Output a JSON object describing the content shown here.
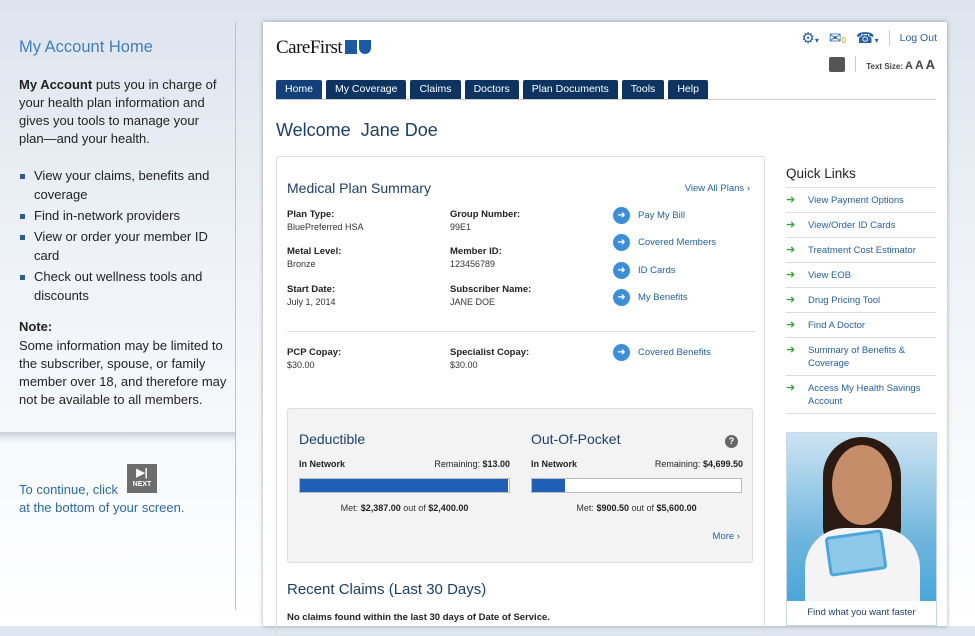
{
  "sidebar": {
    "title": "My Account Home",
    "intro_bold": "My Account",
    "intro_rest": " puts you in charge of your health plan information and gives you tools to manage your plan—and your health.",
    "bullets": [
      "View your claims, benefits and coverage",
      "Find in-network providers",
      "View or order your member ID card",
      "Check out wellness tools and discounts"
    ],
    "note_heading": "Note:",
    "note_text": "Some information may be limited to the subscriber, spouse, or family member over 18, and therefore may not be available to all members.",
    "continue_text_1": "To continue, click",
    "continue_text_2": "at the bottom of your screen.",
    "next_label": "NEXT"
  },
  "header": {
    "logo_text": "CareFirst",
    "mail_badge": "0",
    "logout": "Log Out",
    "text_size_label": "Text Size:",
    "text_sizes": [
      "A",
      "A",
      "A"
    ]
  },
  "tabs": [
    "Home",
    "My Coverage",
    "Claims",
    "Doctors",
    "Plan Documents",
    "Tools",
    "Help"
  ],
  "welcome": "Welcome  Jane Doe",
  "plan": {
    "title": "Medical Plan Summary",
    "view_all": "View All Plans ›",
    "fields": [
      {
        "label": "Plan Type:",
        "value": "BluePreferred HSA"
      },
      {
        "label": "Group Number:",
        "value": "99E1"
      },
      {
        "label": "Metal Level:",
        "value": "Bronze"
      },
      {
        "label": "Member ID:",
        "value": "123456789"
      },
      {
        "label": "Start Date:",
        "value": "July 1, 2014"
      },
      {
        "label": "Subscriber Name:",
        "value": "JANE DOE"
      },
      {
        "label": "PCP Copay:",
        "value": "$30.00"
      },
      {
        "label": "Specialist Copay:",
        "value": "$30.00"
      }
    ],
    "links": [
      "Pay My Bill",
      "Covered Members",
      "ID Cards",
      "My Benefits",
      "Covered Benefits"
    ]
  },
  "deductible": {
    "title": "Deductible",
    "network": "In Network",
    "remaining_label": "Remaining:",
    "remaining": "$13.00",
    "met_label": "Met:",
    "met": "$2,387.00",
    "out_of": "out of",
    "total": "$2,400.00",
    "fill_pct": 99.5
  },
  "oop": {
    "title": "Out-Of-Pocket",
    "network": "In Network",
    "remaining_label": "Remaining:",
    "remaining": "$4,699.50",
    "met_label": "Met:",
    "met": "$900.50",
    "out_of": "out of",
    "total": "$5,600.00",
    "fill_pct": 16
  },
  "more": "More ›",
  "recent_claims": {
    "title": "Recent Claims (Last 30 Days)",
    "empty": "No claims found within the last 30 days of Date of Service."
  },
  "quick_links": {
    "title": "Quick Links",
    "items": [
      "View Payment Options",
      "View/Order ID Cards",
      "Treatment Cost Estimator",
      "View EOB",
      "Drug Pricing Tool",
      "Find A Doctor",
      "Summary of Benefits & Coverage",
      "Access My Health Savings Account"
    ]
  },
  "promo": {
    "caption": "Find what you want faster"
  }
}
